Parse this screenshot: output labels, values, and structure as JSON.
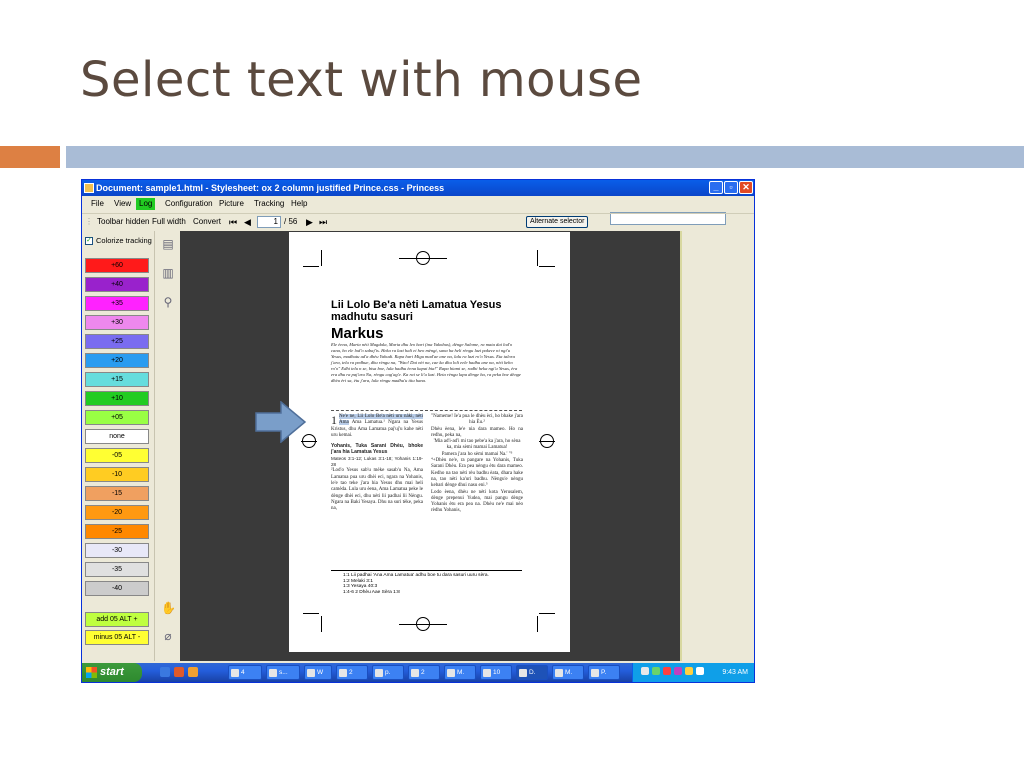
{
  "slide": {
    "title": "Select text with mouse"
  },
  "window": {
    "title": "Document: sample1.html - Stylesheet: ox 2 column justified Prince.css - Princess",
    "menu": [
      "File",
      "View",
      "Log",
      "Configuration",
      "Picture",
      "Tracking",
      "Help"
    ],
    "toolbar": {
      "toolbar_hidden": "Toolbar hidden",
      "full_width": "Full width",
      "convert": "Convert",
      "page_value": "1",
      "page_total": "/ 56",
      "alternate_selector": "Alternate selector"
    }
  },
  "left_panel": {
    "colorize_tracking": "Colorize tracking",
    "swatches": [
      {
        "label": "+60",
        "color": "#ff1a1a"
      },
      {
        "label": "+40",
        "color": "#9922cc"
      },
      {
        "label": "+35",
        "color": "#ff22ff"
      },
      {
        "label": "+30",
        "color": "#ee88ee"
      },
      {
        "label": "+25",
        "color": "#7a6cf0"
      },
      {
        "label": "+20",
        "color": "#2a9cf0"
      },
      {
        "label": "+15",
        "color": "#66dddd"
      },
      {
        "label": "+10",
        "color": "#22cc22"
      },
      {
        "label": "+05",
        "color": "#99ff44"
      },
      {
        "label": "none",
        "color": "#ffffff"
      },
      {
        "label": "-05",
        "color": "#ffff33"
      },
      {
        "label": "-10",
        "color": "#ffcc22"
      },
      {
        "label": "-15",
        "color": "#f0a060"
      },
      {
        "label": "-20",
        "color": "#ff9911"
      },
      {
        "label": "-25",
        "color": "#ff8800"
      },
      {
        "label": "-30",
        "color": "#e8e8f8"
      },
      {
        "label": "-35",
        "color": "#e0e0e0"
      },
      {
        "label": "-40",
        "color": "#cccccc"
      }
    ],
    "add_button": "add 05   ALT +",
    "minus_button": "minus 05   ALT -"
  },
  "document": {
    "title": "Lii Lolo Be'a nèti Lamatua Yesus madhutu sasuri",
    "book": "Markus",
    "intro": "Ele èena, Maria nèti Magdala, Maria dhu leo hari (ina Yakobus), dènge Salome, ra mata dai lod'o cana, ho ele lod'o sabaj'is. Heka ra lazi hali ei heo mèngi, sana ha heli rèngu lazi pakece ni ngi'u Yesus, madhutu ad'a dhèu Yahudi. Rapa hari Migu mad'ae ane na, lalu ra lazi ro'o Yesus. Eta talora j'ara, telu ra pedhue, dhu rèngu na, \"Wao! Dai nèi na, cae ka dhu loli eele hadhu ane na, nèti keho ro'o\" Edhi telu n se, bisa boe, lula hadhu èena kapai bia!\" Rapa hiami se, radhi heka ngi'u Yesus, èra era dhu ra paj'uru Na, rèngu cag'ag'e. Ka rai se li'u lazi. Heta rèngu lapa dènge ha, ra peka boe dènge dhèu èri sa, ètu j'ara, lula rèngu madhu'u titu hana.",
    "left_col": {
      "verse_num": "1",
      "highlighted": "Ne'e ne, Lii Lolo Be'a nèti uru nàki, nèti Ama",
      "rest": "Ama Lamatua.¹ Ngara na Yesus Kristus, dhu Ama Lamatua paj'uj'u kahe nèti uru kemai.",
      "section_heading": "Yohanis, Tuka Sarani Dhèu, bhoke j'ara hia Lamatua Yesus",
      "refs": "Mateos 3:1-12; Lukas 3:1-18; Yohanis 1:19-28",
      "para": "²Lod'o Yesus sab'u mèke sasab'u Na, Ama Lamatua pua uru dhèi eci, ngara na Yohanis, le'e tao teke j'ara hia Yesus dhu mai heli camèda. Lula uru èena, Ama Lamatua peke le dènge dhèi eci, dhu nèti lii padhai lii Nèngu. Ngara na Baki Yesaya. Dhu na suri tèke, peka na,"
    },
    "right_col": {
      "para1": "\"Nameme! Ie'a pua le dhèu èci, ho bhake j'ara hia Èu.²",
      "para2": "Dhèu èena, le'e nia dara mameo. Ho na redhu, peka na,",
      "para3": "'Mia ad'i-ad'i mi tao pebe'a ka j'ara, ho sèna ka, mia sèmi mamai Lamatua!",
      "para4": "Pamera j'ara ho sèmi mamai Na.' \"³",
      "para5": "⁴+Dhèu ne'e, ra pangare na Yohanis, Tuka Sarani Dhèu. Era pea nèngu ètu dara mameo. Kedho na tao nèti rèu badhu èata, dhara hake na, tao nèti ka'uri badhu. Nèngu'e nèngu kebari dènge dhui nasu eni.⁵",
      "para6": "Lodo èena, dhèu ne nèti kota Yerusalem, dènge prepenui Yudea, mai pangu dènge Yohanis ètu era pea na. Dhèu ne'e mai nèo rèdhu Yohanis,"
    },
    "footnotes": [
      "1:1 Lii padhai 'Ana Ama Lamatua' adhu boe tu dara sasuri uuru sèra.",
      "1:2 Melaki 3:1",
      "1:3 Yesaya 40:3",
      "1:4-6 2 Dhèu Aae Sèra 1:8"
    ]
  },
  "taskbar": {
    "start": "start",
    "buttons": [
      "4",
      "s...",
      "W",
      "2",
      "p.",
      "2",
      "M.",
      "10",
      "D.",
      "M.",
      "P."
    ],
    "clock": "9:43 AM"
  },
  "colors": {
    "title_text": "#5b4a3f",
    "accent_orange": "#dd8043",
    "accent_blue": "#a9bcd6",
    "selection": "#b8cce8",
    "arrow_fill": "#7a9ec9"
  }
}
